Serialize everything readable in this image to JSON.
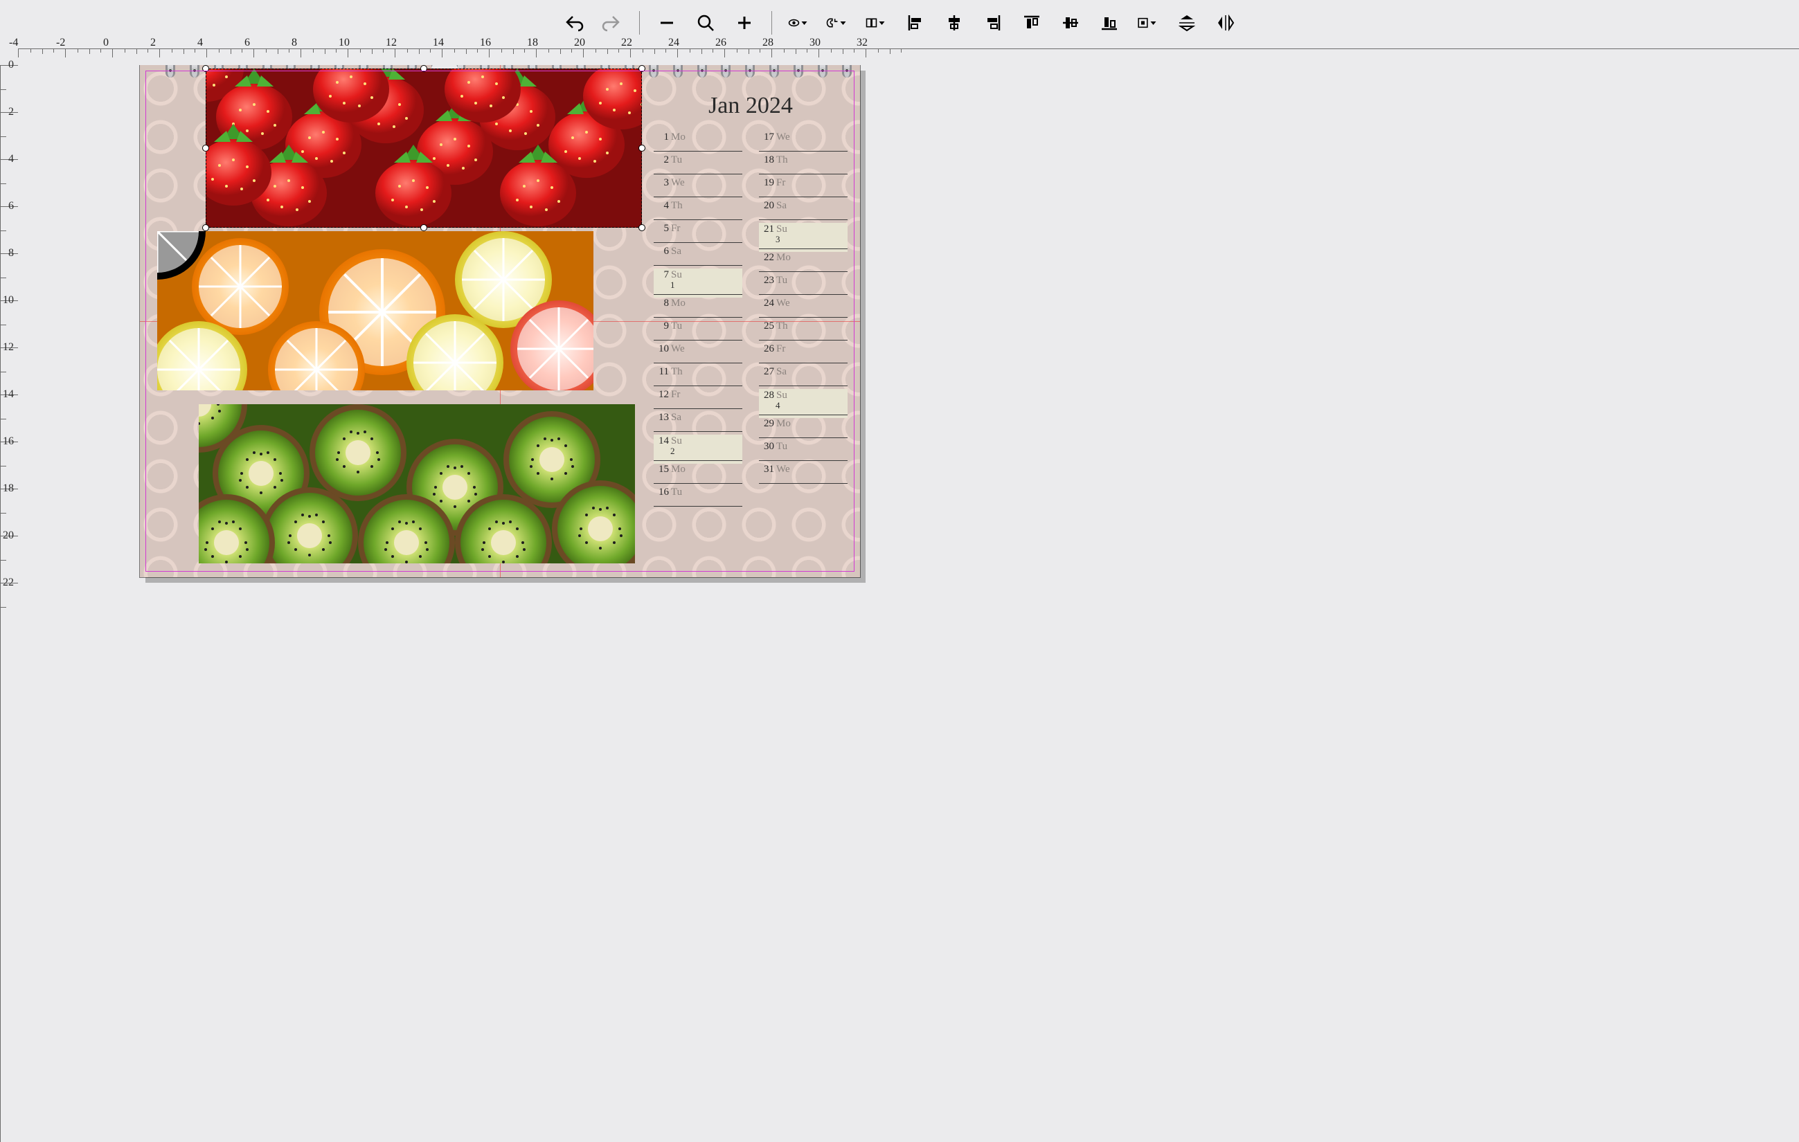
{
  "ruler": {
    "h": [
      "-4",
      "-2",
      "0",
      "2",
      "4",
      "6",
      "8",
      "10",
      "12",
      "14",
      "16",
      "18",
      "20",
      "22",
      "24",
      "26",
      "28",
      "30",
      "32"
    ],
    "v": [
      "0",
      "2",
      "4",
      "6",
      "8",
      "10",
      "12",
      "14",
      "16",
      "18",
      "20",
      "22"
    ]
  },
  "toolbar": [
    {
      "id": "undo",
      "interact": true
    },
    {
      "id": "redo",
      "interact": false,
      "disabled": true
    },
    {
      "sep": true
    },
    {
      "id": "zoom-out",
      "interact": true
    },
    {
      "id": "zoom-fit",
      "interact": true
    },
    {
      "id": "zoom-in",
      "interact": true
    },
    {
      "sep": true
    },
    {
      "id": "visibility",
      "interact": true,
      "dropdown": true
    },
    {
      "id": "snap",
      "interact": true,
      "dropdown": true
    },
    {
      "id": "spread",
      "interact": true,
      "dropdown": true
    },
    {
      "id": "align-left",
      "interact": true
    },
    {
      "id": "align-center-h",
      "interact": true
    },
    {
      "id": "align-right",
      "interact": true
    },
    {
      "id": "align-top",
      "interact": true
    },
    {
      "id": "align-center-v",
      "interact": true
    },
    {
      "id": "align-bottom",
      "interact": true
    },
    {
      "id": "align-page",
      "interact": true,
      "dropdown": true
    },
    {
      "id": "flip-v",
      "interact": true
    },
    {
      "id": "flip-h",
      "interact": true
    }
  ],
  "calendar": {
    "title": "Jan 2024",
    "col1": [
      {
        "n": "1",
        "d": "Mo"
      },
      {
        "n": "2",
        "d": "Tu"
      },
      {
        "n": "3",
        "d": "We"
      },
      {
        "n": "4",
        "d": "Th"
      },
      {
        "n": "5",
        "d": "Fr"
      },
      {
        "n": "6",
        "d": "Sa"
      },
      {
        "n": "7",
        "d": "Su",
        "sun": true,
        "wk": "1"
      },
      {
        "n": "8",
        "d": "Mo"
      },
      {
        "n": "9",
        "d": "Tu"
      },
      {
        "n": "10",
        "d": "We"
      },
      {
        "n": "11",
        "d": "Th"
      },
      {
        "n": "12",
        "d": "Fr"
      },
      {
        "n": "13",
        "d": "Sa"
      },
      {
        "n": "14",
        "d": "Su",
        "sun": true,
        "wk": "2"
      },
      {
        "n": "15",
        "d": "Mo"
      },
      {
        "n": "16",
        "d": "Tu"
      }
    ],
    "col2": [
      {
        "n": "17",
        "d": "We"
      },
      {
        "n": "18",
        "d": "Th"
      },
      {
        "n": "19",
        "d": "Fr"
      },
      {
        "n": "20",
        "d": "Sa"
      },
      {
        "n": "21",
        "d": "Su",
        "sun": true,
        "wk": "3"
      },
      {
        "n": "22",
        "d": "Mo"
      },
      {
        "n": "23",
        "d": "Tu"
      },
      {
        "n": "24",
        "d": "We"
      },
      {
        "n": "25",
        "d": "Th"
      },
      {
        "n": "26",
        "d": "Fr"
      },
      {
        "n": "27",
        "d": "Sa"
      },
      {
        "n": "28",
        "d": "Su",
        "sun": true,
        "wk": "4"
      },
      {
        "n": "29",
        "d": "Mo"
      },
      {
        "n": "30",
        "d": "Tu"
      },
      {
        "n": "31",
        "d": "We"
      }
    ]
  },
  "images": [
    {
      "name": "strawberries",
      "selected": true
    },
    {
      "name": "citrus"
    },
    {
      "name": "kiwi"
    }
  ],
  "guides": {
    "vx": 520,
    "hy": 370
  }
}
